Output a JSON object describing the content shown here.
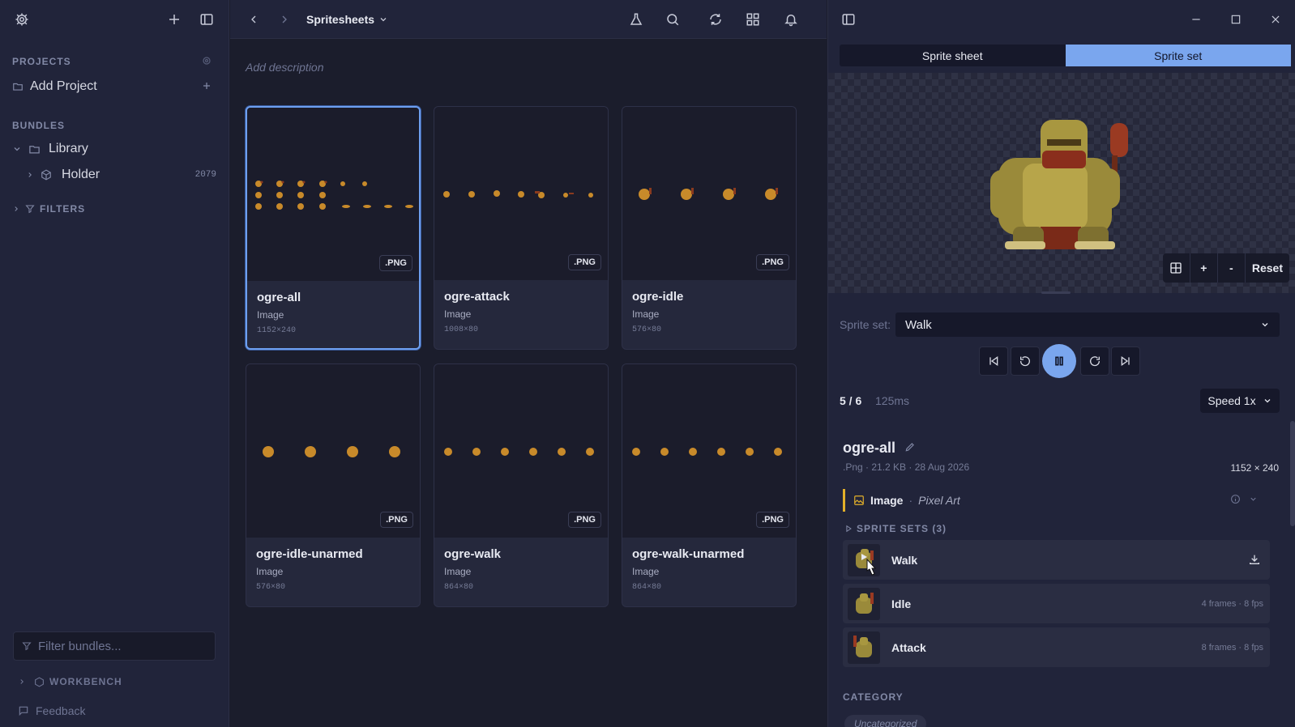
{
  "sidebar": {
    "projects_label": "PROJECTS",
    "add_project": "Add Project",
    "bundles_label": "BUNDLES",
    "library": "Library",
    "holder": "Holder",
    "holder_count": "2079",
    "filters_label": "FILTERS",
    "filter_placeholder": "Filter bundles...",
    "workbench_label": "WORKBENCH",
    "feedback": "Feedback"
  },
  "topbar": {
    "breadcrumb": "Spritesheets"
  },
  "main": {
    "description_placeholder": "Add description",
    "cards": [
      {
        "title": "ogre-all",
        "type": "Image",
        "dims": "1152×240",
        "badge": ".PNG"
      },
      {
        "title": "ogre-attack",
        "type": "Image",
        "dims": "1008×80",
        "badge": ".PNG"
      },
      {
        "title": "ogre-idle",
        "type": "Image",
        "dims": "576×80",
        "badge": ".PNG"
      },
      {
        "title": "ogre-idle-unarmed",
        "type": "Image",
        "dims": "576×80",
        "badge": ".PNG"
      },
      {
        "title": "ogre-walk",
        "type": "Image",
        "dims": "864×80",
        "badge": ".PNG"
      },
      {
        "title": "ogre-walk-unarmed",
        "type": "Image",
        "dims": "864×80",
        "badge": ".PNG"
      }
    ]
  },
  "right": {
    "tabs": [
      "Sprite sheet",
      "Sprite set"
    ],
    "active_tab": "Sprite set",
    "zoom": {
      "fit": "grid-icon",
      "plus": "+",
      "minus": "-",
      "reset": "Reset"
    },
    "sprite_set_label": "Sprite set:",
    "sprite_set_value": "Walk",
    "frame_counter": "5 / 6",
    "frame_time": "125ms",
    "speed": "Speed 1x",
    "file_title": "ogre-all",
    "file_meta": ".Png · 21.2 KB · 28 Aug 2026",
    "file_dims": "1152 × 240",
    "kind": "Image",
    "kind_dot": "·",
    "style": "Pixel Art",
    "sprite_sets_label": "SPRITE SETS (3)",
    "sets": [
      {
        "name": "Walk",
        "meta": ""
      },
      {
        "name": "Idle",
        "meta": "4 frames · 8 fps"
      },
      {
        "name": "Attack",
        "meta": "8 frames · 8 fps"
      }
    ],
    "category_label": "CATEGORY",
    "category_chip": "Uncategorized"
  },
  "colors": {
    "accent": "#7aa6ee",
    "background": "#1b1d2c",
    "panel": "#21243a"
  }
}
